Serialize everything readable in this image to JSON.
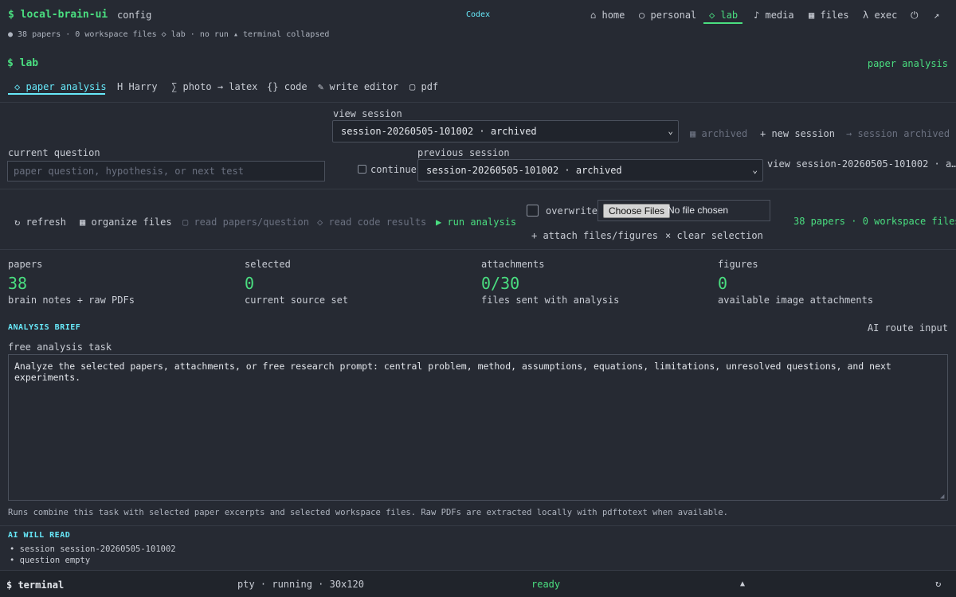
{
  "header": {
    "brand": "$ local-brain-ui",
    "config": "config",
    "center_label": "Codex",
    "nav": [
      {
        "icon": "⌂",
        "label": "home"
      },
      {
        "icon": "○",
        "label": "personal"
      },
      {
        "icon": "◇",
        "label": "lab"
      },
      {
        "icon": "♪",
        "label": "media"
      },
      {
        "icon": "▦",
        "label": "files"
      },
      {
        "icon": "λ",
        "label": "exec"
      }
    ],
    "power_icon": "⏻",
    "expand_icon": "↗",
    "status_line": "● 38 papers · 0 workspace files ◇ lab · no run ▴ terminal collapsed"
  },
  "section": {
    "title": "$ lab",
    "mode": "paper analysis"
  },
  "tabs": [
    {
      "icon": "◇",
      "label": "paper analysis"
    },
    {
      "icon": "H",
      "label": "Harry"
    },
    {
      "icon": "∑",
      "label": "photo → latex"
    },
    {
      "icon": "{}",
      "label": "code"
    },
    {
      "icon": "✎",
      "label": "write editor"
    },
    {
      "icon": "▢",
      "label": "pdf"
    }
  ],
  "session": {
    "view_label": "view session",
    "view_value": "session-20260505-101002 · archived",
    "archived_badge": "▦ archived",
    "new_session": "+ new session",
    "session_archived": "→ session archived",
    "question_label": "current question",
    "question_placeholder": "paper question, hypothesis, or next test",
    "continue_label": "continue",
    "previous_label": "previous session",
    "previous_value": "session-20260505-101002 · archived",
    "view_link": "view session-20260505-101002 · a…"
  },
  "actions": {
    "refresh": "↻ refresh",
    "organize": "▦ organize files",
    "read_papers": "▢ read papers/question",
    "read_code": "◇ read code results",
    "run": "▶ run analysis",
    "overwrite": "overwrite",
    "choose_files": "Choose Files",
    "no_file": "No file chosen",
    "attach": "+ attach files/figures",
    "clear": "× clear selection",
    "summary": "38 papers · 0 workspace files"
  },
  "stats": [
    {
      "label": "papers",
      "value": "38",
      "sub": "brain notes + raw PDFs"
    },
    {
      "label": "selected",
      "value": "0",
      "sub": "current source set"
    },
    {
      "label": "attachments",
      "value": "0/30",
      "sub": "files sent with analysis"
    },
    {
      "label": "figures",
      "value": "0",
      "sub": "available image attachments"
    }
  ],
  "brief": {
    "title": "ANALYSIS BRIEF",
    "route": "AI route input",
    "task_label": "free analysis task",
    "task_text": "Analyze the selected papers, attachments, or free research prompt: central problem, method, assumptions, equations, limitations, unresolved questions, and next experiments.",
    "note": "Runs combine this task with selected paper excerpts and selected workspace files. Raw PDFs are extracted locally with pdftotext when available."
  },
  "ai_read": {
    "title": "AI WILL READ",
    "items": [
      "• session session-20260505-101002",
      "• question empty"
    ]
  },
  "terminal": {
    "title": "$ terminal",
    "meta": "pty · running · 30x120",
    "status": "ready",
    "toggle": "▲",
    "refresh": "↻"
  },
  "colors": {
    "background": "#262a33",
    "accent_green": "#4ade80",
    "accent_cyan": "#67e8f9"
  }
}
